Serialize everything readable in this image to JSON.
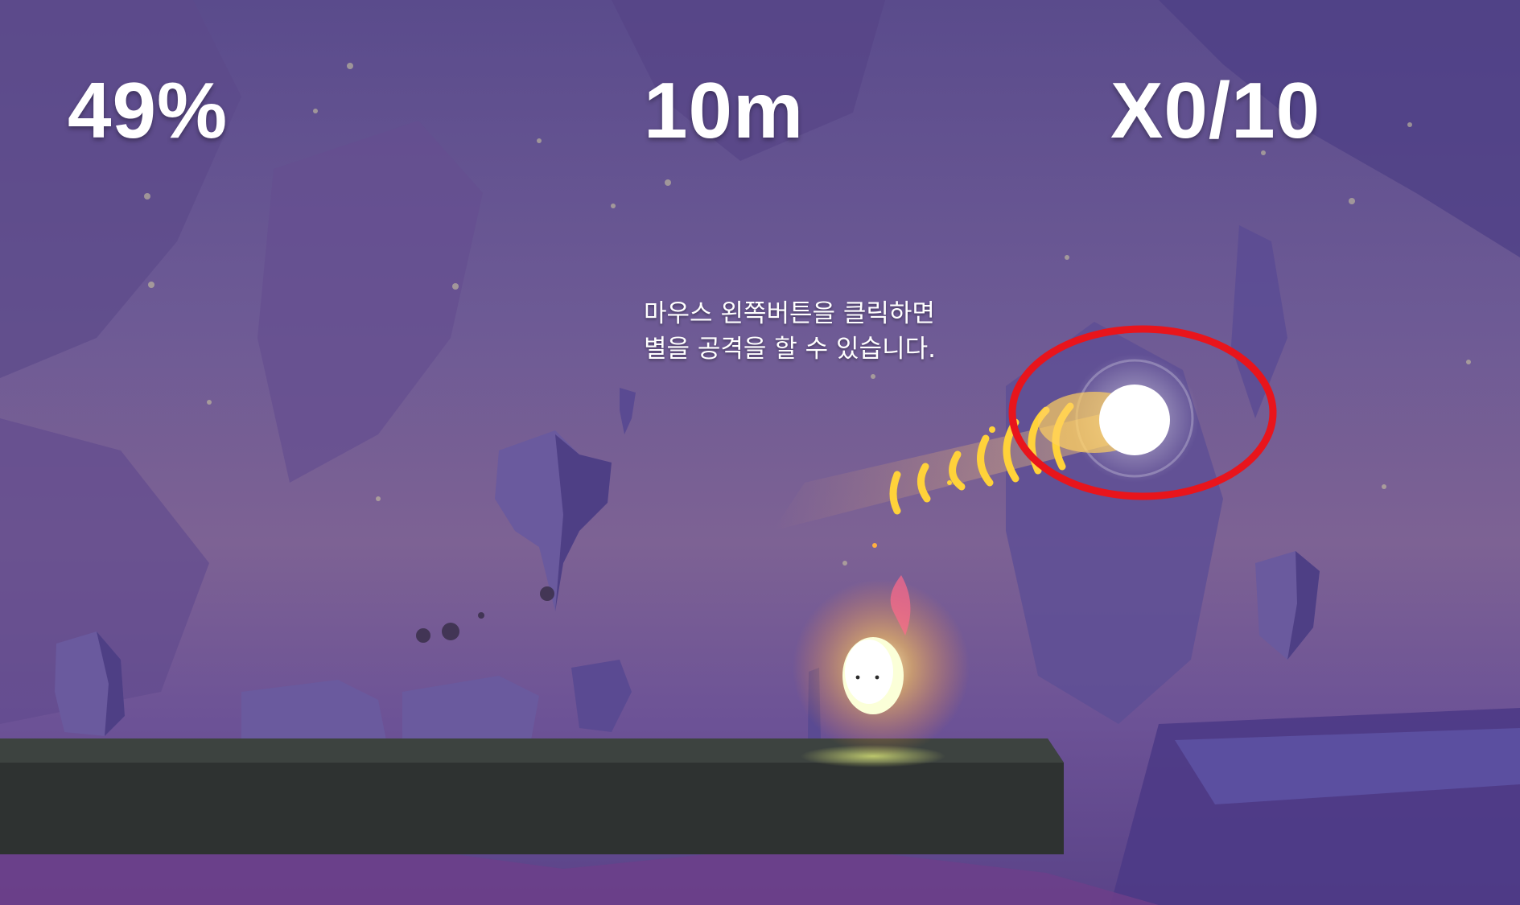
{
  "hud": {
    "progress_text": "49%",
    "distance_text": "10m",
    "stars_text": "X0/10"
  },
  "tutorial": {
    "line1": "마우스 왼쪽버튼을 클릭하면",
    "line2": "별을 공격을 할 수 있습니다."
  },
  "colors": {
    "sky": "#5a4b8c",
    "rock": "#5b4f99",
    "platform_top": "#3d4340",
    "platform_front": "#2e3231",
    "highlight_ring": "#e8151c",
    "hud_text": "#ffffff"
  },
  "icons": {
    "player": "flame-spirit-icon",
    "target": "shooting-star-icon"
  }
}
